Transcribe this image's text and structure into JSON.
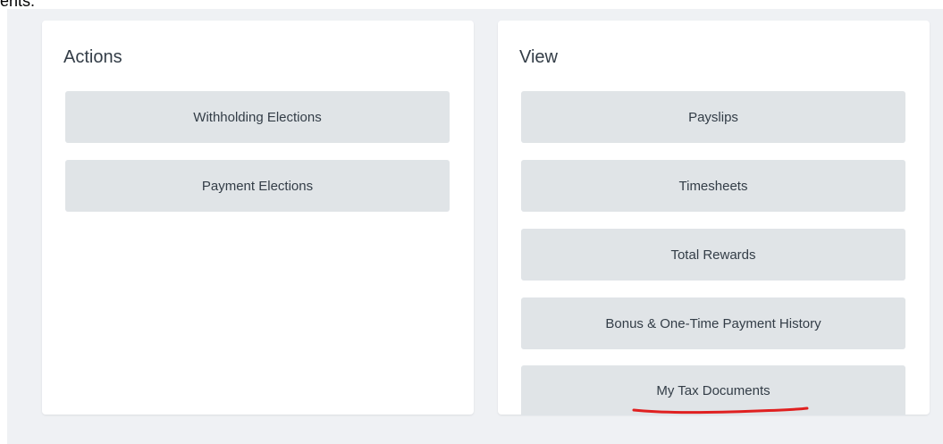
{
  "fragment_text": "ents.",
  "actions": {
    "title": "Actions",
    "items": [
      {
        "label": "Withholding Elections"
      },
      {
        "label": "Payment Elections"
      }
    ]
  },
  "view": {
    "title": "View",
    "items": [
      {
        "label": "Payslips"
      },
      {
        "label": "Timesheets"
      },
      {
        "label": "Total Rewards"
      },
      {
        "label": "Bonus & One-Time Payment History"
      },
      {
        "label": "My Tax Documents"
      }
    ]
  },
  "annotation": {
    "color": "#e02020"
  }
}
